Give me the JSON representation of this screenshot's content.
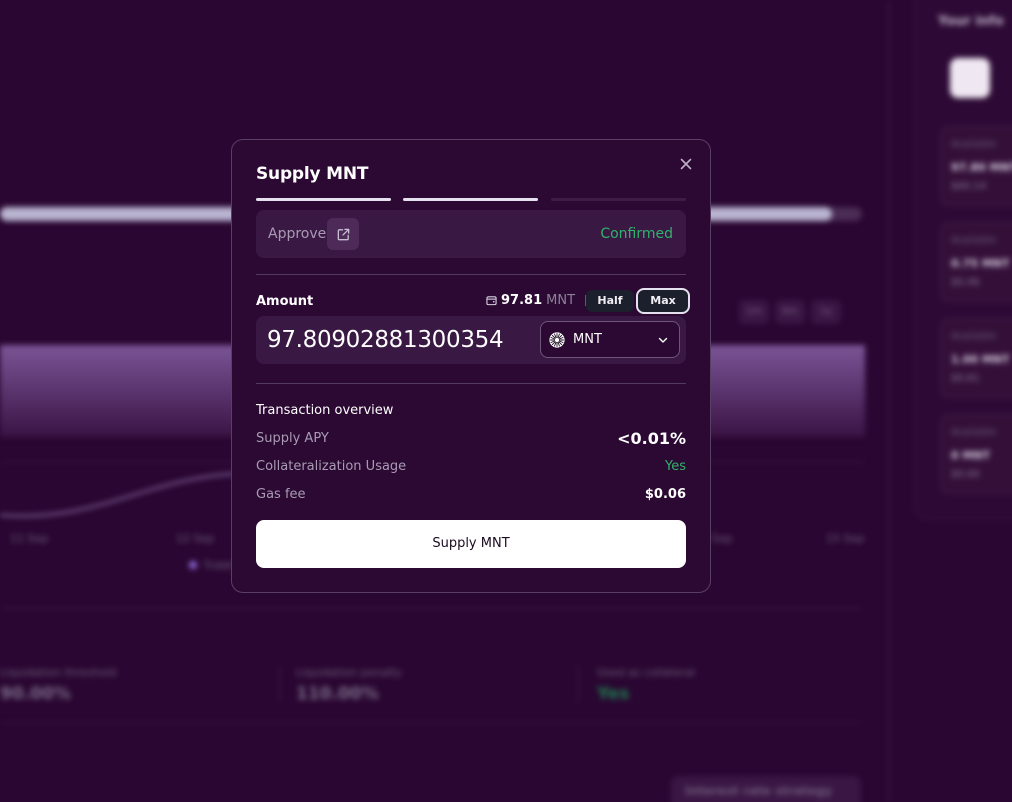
{
  "background": {
    "your_info_title": "Your info",
    "cards": [
      {
        "label": "Available",
        "value": "97.80 MNT",
        "sub": "$60.14"
      },
      {
        "label": "Available",
        "value": "0.75 MNT",
        "sub": "$0.46"
      },
      {
        "label": "Available",
        "value": "1.00 MNT",
        "sub": "$0.61"
      },
      {
        "label": "Available",
        "value": "0 MNT",
        "sub": "$0.00"
      }
    ],
    "range_buttons": [
      "1m",
      "6m",
      "1y"
    ],
    "axis_labels": [
      "11 Sep",
      "12 Sep",
      "13 Sep",
      "15 Sep"
    ],
    "legend": "Supply APR",
    "stats": [
      {
        "label": "Liquidation threshold",
        "value": "90.00%"
      },
      {
        "label": "Liquidation penalty",
        "value": "110.00%"
      },
      {
        "label": "Used as collateral",
        "value": "Yes"
      }
    ],
    "interest_rate_button": "Interest rate strategy"
  },
  "modal": {
    "title": "Supply MNT",
    "steps": [
      "done",
      "done",
      "pending"
    ],
    "approve": {
      "label": "Approve",
      "status": "Confirmed"
    },
    "amount": {
      "label": "Amount",
      "balance_value": "97.81",
      "balance_symbol": "MNT",
      "half_label": "Half",
      "max_label": "Max",
      "input_value": "97.80902881300354",
      "token": "MNT"
    },
    "overview": {
      "title": "Transaction overview",
      "rows": [
        {
          "label": "Supply APY",
          "value": "<0.01%"
        },
        {
          "label": "Collateralization Usage",
          "value": "Yes"
        },
        {
          "label": "Gas fee",
          "value": "$0.06"
        }
      ]
    },
    "submit_label": "Supply MNT"
  },
  "colors": {
    "background": "#2a0732",
    "modal": "#2b0933",
    "success": "#2fb36a",
    "primary_button": "#ffffff"
  }
}
